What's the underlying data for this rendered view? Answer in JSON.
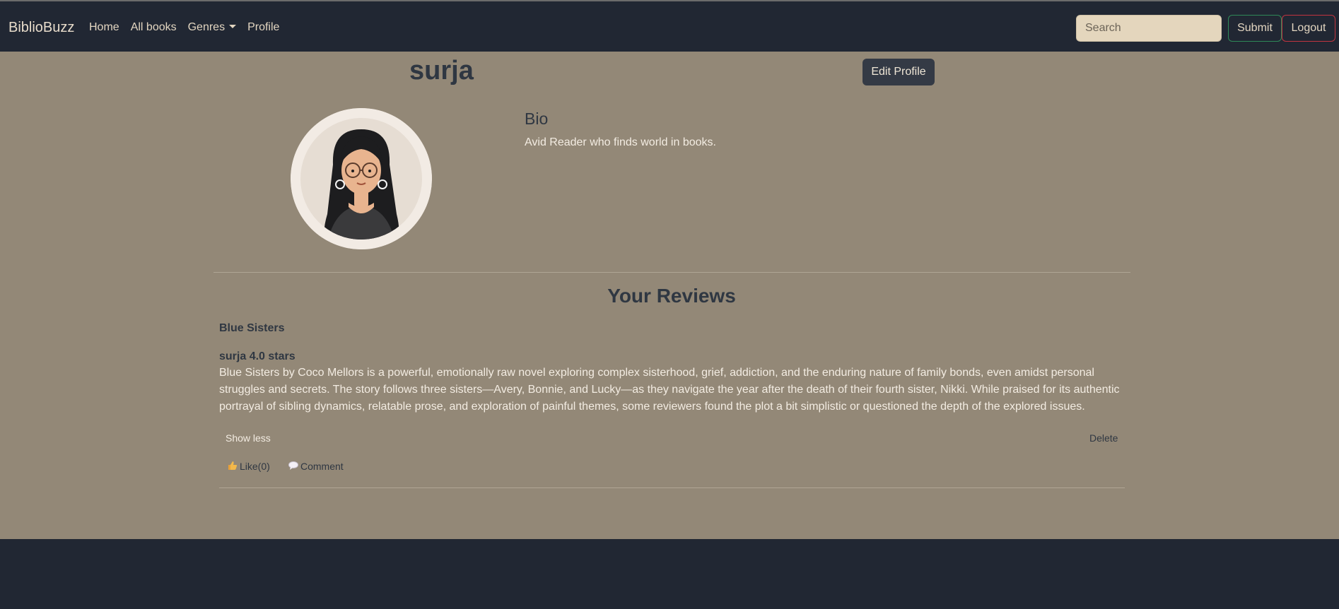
{
  "navbar": {
    "brand": "BiblioBuzz",
    "links": [
      "Home",
      "All books",
      "Genres",
      "Profile"
    ],
    "search_placeholder": "Search",
    "submit_label": "Submit",
    "logout_label": "Logout"
  },
  "profile": {
    "username": "surja",
    "edit_label": "Edit Profile",
    "bio_title": "Bio",
    "bio_text": "Avid Reader who finds world in books."
  },
  "reviews": {
    "section_title": "Your Reviews",
    "items": [
      {
        "book_title": "Blue Sisters",
        "author_line": "surja 4.0 stars",
        "text": "Blue Sisters by Coco Mellors is a powerful, emotionally raw novel exploring complex sisterhood, grief, addiction, and the enduring nature of family bonds, even amidst personal struggles and secrets. The story follows three sisters—Avery, Bonnie, and Lucky—as they navigate the year after the death of their fourth sister, Nikki. While praised for its authentic portrayal of sibling dynamics, relatable prose, and exploration of painful themes, some reviewers found the plot a bit simplistic or questioned the depth of the explored issues.",
        "show_less_label": "Show less",
        "delete_label": "Delete",
        "like_label": "Like(0)",
        "comment_label": "Comment"
      }
    ]
  },
  "colors": {
    "navbar_bg": "#212733",
    "main_bg": "#938877",
    "search_bg": "#e4d6bd",
    "submit_border": "#2f8a58",
    "logout_border": "#c2343f"
  }
}
